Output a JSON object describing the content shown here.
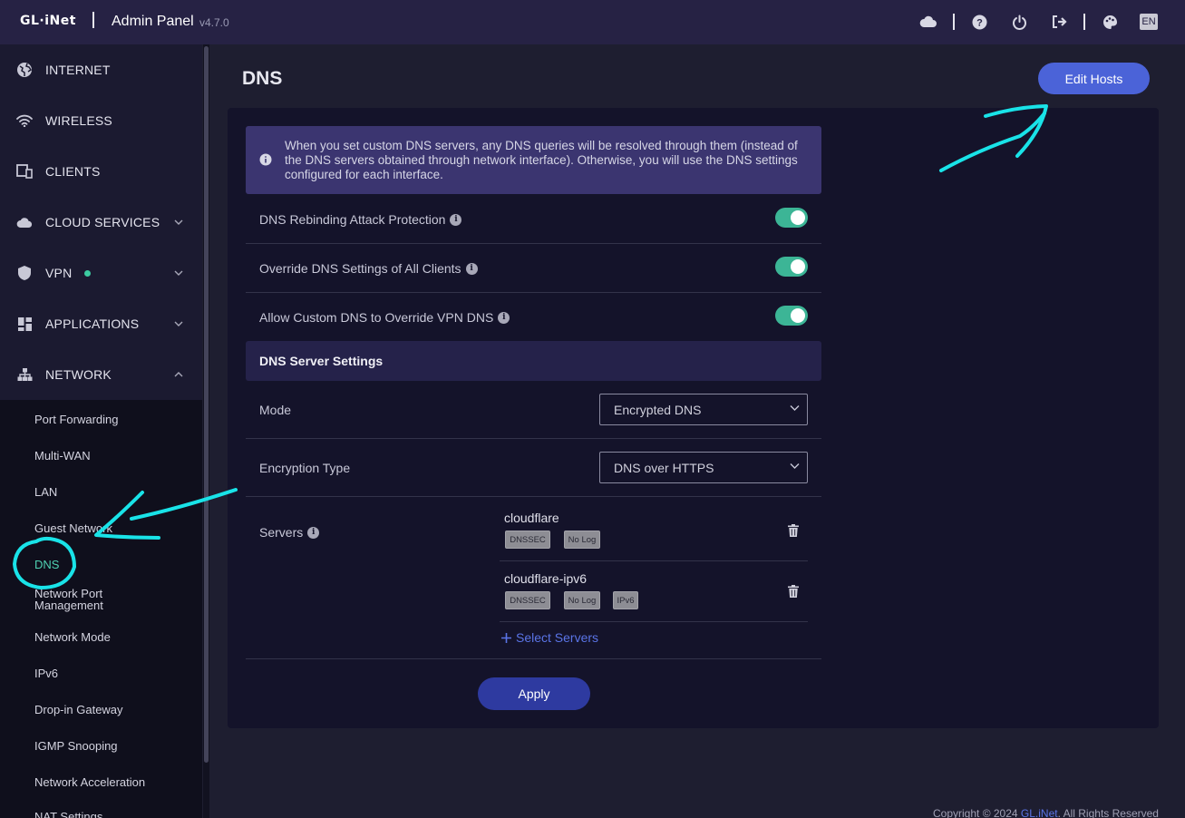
{
  "header": {
    "logo": "GL·iNet",
    "title": "Admin Panel",
    "version": "v4.7.0",
    "icons": [
      "cloud-icon",
      "help-icon",
      "power-icon",
      "logout-icon",
      "palette-icon"
    ],
    "language": "EN"
  },
  "sidebar": {
    "items": [
      {
        "label": "INTERNET",
        "icon": "globe-icon"
      },
      {
        "label": "WIRELESS",
        "icon": "wifi-icon"
      },
      {
        "label": "CLIENTS",
        "icon": "devices-icon"
      },
      {
        "label": "CLOUD SERVICES",
        "icon": "cloud-icon"
      },
      {
        "label": "VPN",
        "icon": "shield-icon"
      },
      {
        "label": "APPLICATIONS",
        "icon": "apps-grid-icon"
      },
      {
        "label": "NETWORK",
        "icon": "network-tree-icon"
      }
    ],
    "network_sub": [
      "Port Forwarding",
      "Multi-WAN",
      "LAN",
      "Guest Network",
      "DNS",
      "Network Port Management",
      "Network Mode",
      "IPv6",
      "Drop-in Gateway",
      "IGMP Snooping",
      "Network Acceleration",
      "NAT Settings"
    ],
    "active_sub": "DNS"
  },
  "main": {
    "title": "DNS",
    "edit_hosts": "Edit Hosts",
    "info": "When you set custom DNS servers, any DNS queries will be resolved through them (instead of the DNS servers obtained through network interface). Otherwise, you will use the DNS settings configured for each interface.",
    "toggles": [
      {
        "label": "DNS Rebinding Attack Protection",
        "on": true
      },
      {
        "label": "Override DNS Settings of All Clients",
        "on": true
      },
      {
        "label": "Allow Custom DNS to Override VPN DNS",
        "on": true
      }
    ],
    "server_section": "DNS Server Settings",
    "mode_label": "Mode",
    "mode_value": "Encrypted DNS",
    "enc_label": "Encryption Type",
    "enc_value": "DNS over HTTPS",
    "servers_label": "Servers",
    "servers": [
      {
        "name": "cloudflare",
        "tags": [
          "DNSSEC",
          "No Log"
        ]
      },
      {
        "name": "cloudflare-ipv6",
        "tags": [
          "DNSSEC",
          "No Log",
          "IPv6"
        ]
      }
    ],
    "select_servers": "Select Servers",
    "apply": "Apply"
  },
  "footer": {
    "prefix": "Copyright © 2024",
    "link": "GL.iNet",
    "suffix": ". All Rights Reserved"
  },
  "colors": {
    "accent": "#4b63d8",
    "toggle_on": "#3cb596",
    "active_nav": "#4fd1b2",
    "annotation": "#19e3e8"
  }
}
